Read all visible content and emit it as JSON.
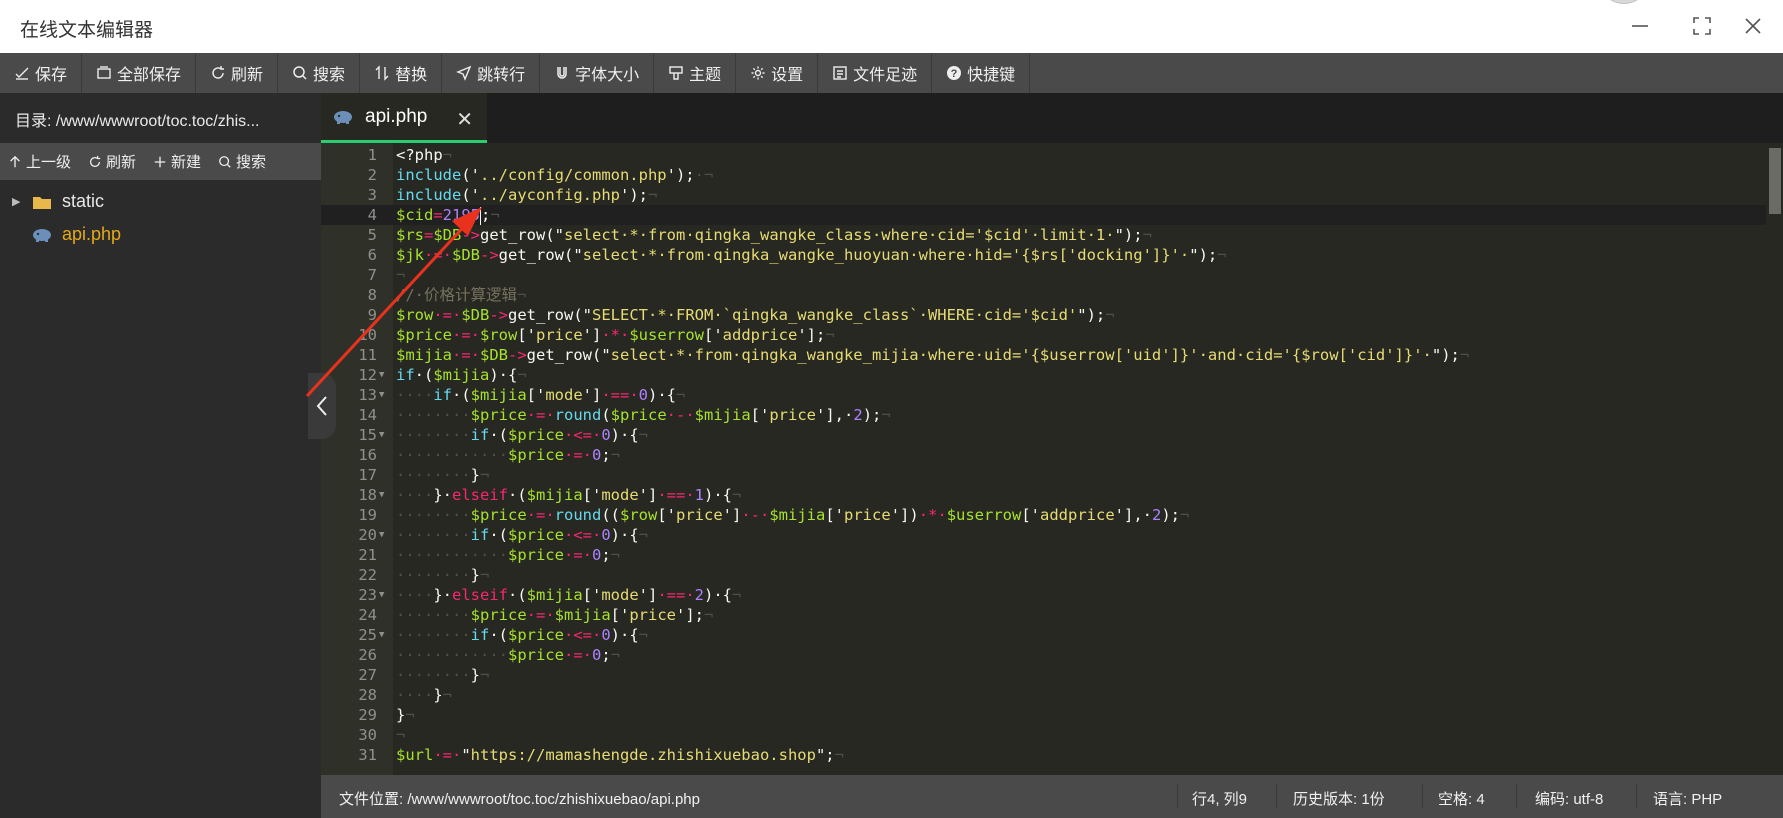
{
  "window": {
    "title": "在线文本编辑器",
    "controls": [
      "minimize",
      "maximize",
      "close"
    ]
  },
  "toolbar": [
    {
      "label": "保存",
      "icon": "save-icon"
    },
    {
      "label": "全部保存",
      "icon": "save-all-icon"
    },
    {
      "label": "刷新",
      "icon": "refresh-icon"
    },
    {
      "label": "搜索",
      "icon": "search-icon"
    },
    {
      "label": "替换",
      "icon": "replace-icon"
    },
    {
      "label": "跳转行",
      "icon": "goto-line-icon"
    },
    {
      "label": "字体大小",
      "icon": "font-size-icon"
    },
    {
      "label": "主题",
      "icon": "theme-icon"
    },
    {
      "label": "设置",
      "icon": "settings-icon"
    },
    {
      "label": "文件足迹",
      "icon": "history-icon"
    },
    {
      "label": "快捷键",
      "icon": "help-icon"
    }
  ],
  "sidebar": {
    "path": "目录: /www/wwwroot/toc.toc/zhis...",
    "actions": [
      {
        "label": "上一级",
        "icon": "up-arrow-icon"
      },
      {
        "label": "刷新",
        "icon": "refresh-icon"
      },
      {
        "label": "新建",
        "icon": "plus-icon"
      },
      {
        "label": "搜索",
        "icon": "search-icon"
      }
    ],
    "tree": [
      {
        "name": "static",
        "type": "folder"
      },
      {
        "name": "api.php",
        "type": "file"
      }
    ]
  },
  "tabs": [
    {
      "name": "api.php",
      "active": true
    }
  ],
  "editor": {
    "active_line": 4,
    "lines": [
      [
        [
          "<?php",
          "pl"
        ],
        [
          "¬",
          "ws"
        ]
      ],
      [
        [
          "include",
          "kw"
        ],
        [
          "('",
          "pl"
        ],
        [
          "../config/common.php",
          "str"
        ],
        [
          "');",
          "pl"
        ],
        [
          "·¬",
          "ws"
        ]
      ],
      [
        [
          "include",
          "kw"
        ],
        [
          "('",
          "pl"
        ],
        [
          "../ayconfig.php",
          "str"
        ],
        [
          "');",
          "pl"
        ],
        [
          "¬",
          "ws"
        ]
      ],
      [
        [
          "$cid",
          "var"
        ],
        [
          "=",
          "op"
        ],
        [
          "2195",
          "num"
        ],
        [
          "|",
          "caret"
        ],
        [
          ";",
          "pl"
        ],
        [
          "¬",
          "ws"
        ]
      ],
      [
        [
          "$rs",
          "var"
        ],
        [
          "=",
          "op"
        ],
        [
          "$DB",
          "var"
        ],
        [
          "->",
          "op"
        ],
        [
          "get_row",
          "pl"
        ],
        [
          "(\"",
          "pl"
        ],
        [
          "select·*·from·qingka_wangke_class·where·cid='$cid'·limit·1·",
          "str"
        ],
        [
          "\");",
          "pl"
        ],
        [
          "¬",
          "ws"
        ]
      ],
      [
        [
          "$jk",
          "var"
        ],
        [
          "·=·",
          "op"
        ],
        [
          "$DB",
          "var"
        ],
        [
          "->",
          "op"
        ],
        [
          "get_row",
          "pl"
        ],
        [
          "(\"",
          "pl"
        ],
        [
          "select·*·from·qingka_wangke_huoyuan·where·hid='{$rs['docking']}'·",
          "str"
        ],
        [
          "\");",
          "pl"
        ],
        [
          "¬",
          "ws"
        ]
      ],
      [
        [
          "¬",
          "ws"
        ]
      ],
      [
        [
          "//·价格计算逻辑",
          "cm"
        ],
        [
          "¬",
          "ws"
        ]
      ],
      [
        [
          "$row",
          "var"
        ],
        [
          "·=·",
          "op"
        ],
        [
          "$DB",
          "var"
        ],
        [
          "->",
          "op"
        ],
        [
          "get_row",
          "pl"
        ],
        [
          "(\"",
          "pl"
        ],
        [
          "SELECT·*·FROM·`qingka_wangke_class`·WHERE·cid='$cid'",
          "str"
        ],
        [
          "\");",
          "pl"
        ],
        [
          "¬",
          "ws"
        ]
      ],
      [
        [
          "$price",
          "var"
        ],
        [
          "·=·",
          "op"
        ],
        [
          "$row",
          "var"
        ],
        [
          "['",
          "pl"
        ],
        [
          "price",
          "str"
        ],
        [
          "']",
          "pl"
        ],
        [
          "·*·",
          "op"
        ],
        [
          "$userrow",
          "var"
        ],
        [
          "['",
          "pl"
        ],
        [
          "addprice",
          "str"
        ],
        [
          "'];",
          "pl"
        ],
        [
          "¬",
          "ws"
        ]
      ],
      [
        [
          "$mijia",
          "var"
        ],
        [
          "·=·",
          "op"
        ],
        [
          "$DB",
          "var"
        ],
        [
          "->",
          "op"
        ],
        [
          "get_row",
          "pl"
        ],
        [
          "(\"",
          "pl"
        ],
        [
          "select·*·from·qingka_wangke_mijia·where·uid='{$userrow['uid']}'·and·cid='{$row['cid']}'·",
          "str"
        ],
        [
          "\");",
          "pl"
        ],
        [
          "¬",
          "ws"
        ]
      ],
      [
        [
          "if",
          "kw"
        ],
        [
          "·(",
          "pl"
        ],
        [
          "$mijia",
          "var"
        ],
        [
          ")·{",
          "pl"
        ],
        [
          "¬",
          "ws"
        ]
      ],
      [
        [
          "····",
          "ws"
        ],
        [
          "if",
          "kw"
        ],
        [
          "·(",
          "pl"
        ],
        [
          "$mijia",
          "var"
        ],
        [
          "['",
          "pl"
        ],
        [
          "mode",
          "str"
        ],
        [
          "']",
          "pl"
        ],
        [
          "·==·",
          "op"
        ],
        [
          "0",
          "num"
        ],
        [
          ")·{",
          "pl"
        ],
        [
          "¬",
          "ws"
        ]
      ],
      [
        [
          "········",
          "ws"
        ],
        [
          "$price",
          "var"
        ],
        [
          "·=·",
          "op"
        ],
        [
          "round",
          "kw"
        ],
        [
          "(",
          "pl"
        ],
        [
          "$price",
          "var"
        ],
        [
          "·-·",
          "op"
        ],
        [
          "$mijia",
          "var"
        ],
        [
          "['",
          "pl"
        ],
        [
          "price",
          "str"
        ],
        [
          "'],·",
          "pl"
        ],
        [
          "2",
          "num"
        ],
        [
          ");",
          "pl"
        ],
        [
          "¬",
          "ws"
        ]
      ],
      [
        [
          "········",
          "ws"
        ],
        [
          "if",
          "kw"
        ],
        [
          "·(",
          "pl"
        ],
        [
          "$price",
          "var"
        ],
        [
          "·<=·",
          "op"
        ],
        [
          "0",
          "num"
        ],
        [
          ")·{",
          "pl"
        ],
        [
          "¬",
          "ws"
        ]
      ],
      [
        [
          "············",
          "ws"
        ],
        [
          "$price",
          "var"
        ],
        [
          "·=·",
          "op"
        ],
        [
          "0",
          "num"
        ],
        [
          ";",
          "pl"
        ],
        [
          "¬",
          "ws"
        ]
      ],
      [
        [
          "········",
          "ws"
        ],
        [
          "}",
          "pl"
        ],
        [
          "¬",
          "ws"
        ]
      ],
      [
        [
          "····",
          "ws"
        ],
        [
          "}·",
          "pl"
        ],
        [
          "elseif",
          "op"
        ],
        [
          "·(",
          "pl"
        ],
        [
          "$mijia",
          "var"
        ],
        [
          "['",
          "pl"
        ],
        [
          "mode",
          "str"
        ],
        [
          "']",
          "pl"
        ],
        [
          "·==·",
          "op"
        ],
        [
          "1",
          "num"
        ],
        [
          ")·{",
          "pl"
        ],
        [
          "¬",
          "ws"
        ]
      ],
      [
        [
          "········",
          "ws"
        ],
        [
          "$price",
          "var"
        ],
        [
          "·=·",
          "op"
        ],
        [
          "round",
          "kw"
        ],
        [
          "((",
          "pl"
        ],
        [
          "$row",
          "var"
        ],
        [
          "['",
          "pl"
        ],
        [
          "price",
          "str"
        ],
        [
          "']",
          "pl"
        ],
        [
          "·-·",
          "op"
        ],
        [
          "$mijia",
          "var"
        ],
        [
          "['",
          "pl"
        ],
        [
          "price",
          "str"
        ],
        [
          "'])",
          "pl"
        ],
        [
          "·*·",
          "op"
        ],
        [
          "$userrow",
          "var"
        ],
        [
          "['",
          "pl"
        ],
        [
          "addprice",
          "str"
        ],
        [
          "'],·",
          "pl"
        ],
        [
          "2",
          "num"
        ],
        [
          ");",
          "pl"
        ],
        [
          "¬",
          "ws"
        ]
      ],
      [
        [
          "········",
          "ws"
        ],
        [
          "if",
          "kw"
        ],
        [
          "·(",
          "pl"
        ],
        [
          "$price",
          "var"
        ],
        [
          "·<=·",
          "op"
        ],
        [
          "0",
          "num"
        ],
        [
          ")·{",
          "pl"
        ],
        [
          "¬",
          "ws"
        ]
      ],
      [
        [
          "············",
          "ws"
        ],
        [
          "$price",
          "var"
        ],
        [
          "·=·",
          "op"
        ],
        [
          "0",
          "num"
        ],
        [
          ";",
          "pl"
        ],
        [
          "¬",
          "ws"
        ]
      ],
      [
        [
          "········",
          "ws"
        ],
        [
          "}",
          "pl"
        ],
        [
          "¬",
          "ws"
        ]
      ],
      [
        [
          "····",
          "ws"
        ],
        [
          "}·",
          "pl"
        ],
        [
          "elseif",
          "op"
        ],
        [
          "·(",
          "pl"
        ],
        [
          "$mijia",
          "var"
        ],
        [
          "['",
          "pl"
        ],
        [
          "mode",
          "str"
        ],
        [
          "']",
          "pl"
        ],
        [
          "·==·",
          "op"
        ],
        [
          "2",
          "num"
        ],
        [
          ")·{",
          "pl"
        ],
        [
          "¬",
          "ws"
        ]
      ],
      [
        [
          "········",
          "ws"
        ],
        [
          "$price",
          "var"
        ],
        [
          "·=·",
          "op"
        ],
        [
          "$mijia",
          "var"
        ],
        [
          "['",
          "pl"
        ],
        [
          "price",
          "str"
        ],
        [
          "'];",
          "pl"
        ],
        [
          "¬",
          "ws"
        ]
      ],
      [
        [
          "········",
          "ws"
        ],
        [
          "if",
          "kw"
        ],
        [
          "·(",
          "pl"
        ],
        [
          "$price",
          "var"
        ],
        [
          "·<=·",
          "op"
        ],
        [
          "0",
          "num"
        ],
        [
          ")·{",
          "pl"
        ],
        [
          "¬",
          "ws"
        ]
      ],
      [
        [
          "············",
          "ws"
        ],
        [
          "$price",
          "var"
        ],
        [
          "·=·",
          "op"
        ],
        [
          "0",
          "num"
        ],
        [
          ";",
          "pl"
        ],
        [
          "¬",
          "ws"
        ]
      ],
      [
        [
          "········",
          "ws"
        ],
        [
          "}",
          "pl"
        ],
        [
          "¬",
          "ws"
        ]
      ],
      [
        [
          "····",
          "ws"
        ],
        [
          "}",
          "pl"
        ],
        [
          "¬",
          "ws"
        ]
      ],
      [
        [
          "}",
          "pl"
        ],
        [
          "¬",
          "ws"
        ]
      ],
      [
        [
          "¬",
          "ws"
        ]
      ],
      [
        [
          "$url",
          "var"
        ],
        [
          "·=·",
          "op"
        ],
        [
          "\"",
          "pl"
        ],
        [
          "https://mamashengde.zhishixuebao.shop",
          "str"
        ],
        [
          "\";",
          "pl"
        ],
        [
          "¬",
          "ws"
        ]
      ]
    ],
    "fold_lines": [
      12,
      13,
      15,
      18,
      20,
      23,
      25
    ]
  },
  "statusbar": {
    "file_path": "文件位置: /www/wwwroot/toc.toc/zhishixuebao/api.php",
    "position": "行4, 列9",
    "history": "历史版本: 1份",
    "indent": "空格: 4",
    "encoding": "编码: utf-8",
    "language": "语言: PHP"
  },
  "colors": {
    "editor_bg": "#272822",
    "toolbar_bg": "#4a4a4a",
    "sidebar_bg": "#2b2b2b",
    "tab_accent": "#2ecc71",
    "file_active": "#e6a817",
    "folder": "#e8b84a",
    "annotation_arrow": "#e8321e"
  }
}
